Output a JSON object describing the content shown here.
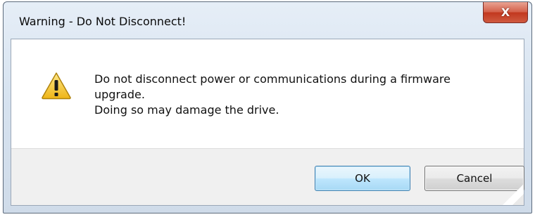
{
  "dialog": {
    "title": "Warning - Do Not Disconnect!",
    "close_glyph": "X",
    "icon": "warning-icon",
    "message_lines": [
      "Do not disconnect power or communications during a firmware",
      "upgrade.",
      "Doing so may damage the drive."
    ],
    "buttons": {
      "ok": "OK",
      "cancel": "Cancel"
    }
  },
  "colors": {
    "close_button": "#c9462c",
    "ok_border": "#3c7fb1",
    "warning_yellow": "#f6c93a",
    "frame": "#d7e3f0"
  }
}
